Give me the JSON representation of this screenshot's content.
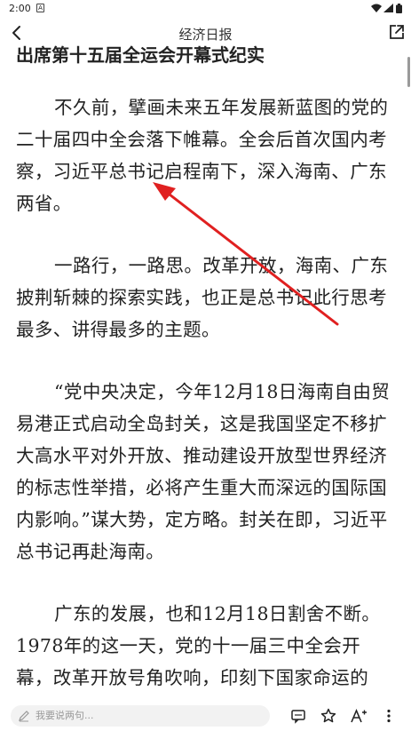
{
  "status": {
    "time": "2:00",
    "notification_glyph": "A"
  },
  "header": {
    "title": "经济日报"
  },
  "article": {
    "headline": "出席第十五届全运会开幕式纪实",
    "paragraphs": [
      "不久前，擘画未来五年发展新蓝图的党的二十届四中全会落下帷幕。全会后首次国内考察，习近平总书记启程南下，深入海南、广东两省。",
      "一路行，一路思。改革开放，海南、广东披荆斩棘的探索实践，也正是总书记此行思考最多、讲得最多的主题。",
      "“党中央决定，今年12月18日海南自由贸易港正式启动全岛封关，这是我国坚定不移扩大高水平对外开放、推动建设开放型世界经济的标志性举措，必将产生重大而深远的国际国内影响。”谋大势，定方略。封关在即，习近平总书记再赴海南。",
      "广东的发展，也和12月18日割舍不断。1978年的这一天，党的十一届三中全会开幕，改革开放号角吹响，印刻下国家命运的"
    ]
  },
  "bottom": {
    "comment_placeholder": "我要说两句..."
  },
  "colors": {
    "annotation_arrow": "#e02020",
    "scrollbar": "#9a9a9a"
  }
}
